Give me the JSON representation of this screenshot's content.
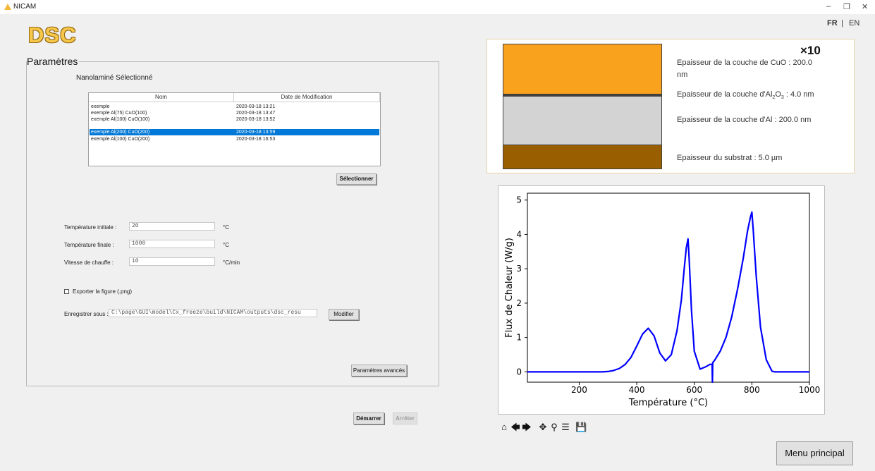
{
  "window": {
    "title": "NICAM",
    "minimize_icon": "minimize-icon",
    "restore_icon": "restore-icon",
    "close_icon": "close-icon"
  },
  "language": {
    "fr": "FR",
    "separator": "|",
    "en": "EN"
  },
  "logo_text": "DSC",
  "parametres": {
    "title": "Paramètres",
    "nano_label": "Nanolaminé Sélectionné",
    "list": {
      "columns": [
        "Nom",
        "Date de Modification"
      ],
      "rows": [
        {
          "name": "exemple",
          "date": "2020-03-18 13:21",
          "selected": false
        },
        {
          "name": "exemple Al(75) CuO(100)",
          "date": "2020-03-18 13:47",
          "selected": false
        },
        {
          "name": "exemple Al(100) CuO(100)",
          "date": "2020-03-18 13:52",
          "selected": false
        },
        {
          "name": "exemple Al(200) CuO(200)",
          "date": "2020-03-18 13:59",
          "selected": true
        },
        {
          "name": "exemple Al(100) CuO(200)",
          "date": "2020-03-18 16:53",
          "selected": false
        }
      ]
    },
    "select_button": "Sélectionner",
    "temp_init_label": "Température initiale :",
    "temp_init_value": "20",
    "temp_init_unit": "°C",
    "temp_final_label": "Température finale :",
    "temp_final_value": "1000",
    "temp_final_unit": "°C",
    "rate_label": "Vitesse de chauffe :",
    "rate_value": "10",
    "rate_unit": "°C/min",
    "export_label": "Exporter la figure (.png)",
    "export_checked": false,
    "save_label": "Enregistrer sous :",
    "save_path": "C:\\page\\GUI\\model\\Cx_freeze\\build\\NICAM\\outputs\\dsc_resu",
    "modify_button": "Modifier",
    "advanced_button": "Paramètres avancés"
  },
  "start_button": "Démarrer",
  "stop_button": "Arrêter",
  "stack": {
    "multiplier": "×10",
    "cuo_label": "Epaisseur de la couche de CuO : 200.0",
    "cuo_label_2": "nm",
    "al2o3_label_pre": "Epaisseur de la couche d'Al",
    "al2o3_sub1": "2",
    "al2o3_mid": "O",
    "al2o3_sub2": "3",
    "al2o3_post": " : 4.0 nm",
    "al_label": "Epaisseur de la couche d'Al : 200.0 nm",
    "substrate_label": "Epaisseur du substrat : 5.0 µm",
    "colors": {
      "cuo": "#f9a21e",
      "al2o3": "#404040",
      "al": "#d3d3d3",
      "substrate": "#995e00"
    }
  },
  "chart_data": {
    "type": "line",
    "xlabel": "Température (°C)",
    "ylabel": "Flux de Chaleur (W/g)",
    "xlim": [
      20,
      1000
    ],
    "ylim": [
      -0.3,
      5.2
    ],
    "xticks": [
      200,
      400,
      600,
      800,
      1000
    ],
    "yticks": [
      0,
      1,
      2,
      3,
      4,
      5
    ],
    "line_color": "#0000ff",
    "series": [
      {
        "x": [
          20,
          280,
          300,
          320,
          340,
          360,
          380,
          400,
          420,
          440,
          460,
          480,
          500,
          520,
          540,
          555,
          565,
          572,
          578,
          582,
          590,
          600,
          620,
          640,
          655,
          662,
          663,
          664,
          670,
          690,
          710,
          730,
          750,
          770,
          785,
          795,
          800,
          805,
          815,
          830,
          850,
          870,
          880,
          900,
          1000
        ],
        "y": [
          0,
          0,
          0.01,
          0.04,
          0.1,
          0.22,
          0.42,
          0.75,
          1.1,
          1.27,
          1.05,
          0.55,
          0.32,
          0.5,
          1.2,
          2.1,
          3.0,
          3.6,
          3.87,
          3.3,
          1.8,
          0.6,
          0.08,
          0.15,
          0.22,
          0.22,
          -0.5,
          0.27,
          0.33,
          0.6,
          1.0,
          1.6,
          2.4,
          3.3,
          4.1,
          4.5,
          4.65,
          4.1,
          2.8,
          1.3,
          0.35,
          0.02,
          0,
          0,
          0
        ]
      }
    ]
  },
  "toolbar": {
    "home": "home-icon",
    "back": "back-arrow-icon",
    "forward": "forward-arrow-icon",
    "pan": "pan-icon",
    "zoom": "zoom-icon",
    "configure": "configure-subplots-icon",
    "save": "save-icon"
  },
  "menu_button": "Menu principal"
}
